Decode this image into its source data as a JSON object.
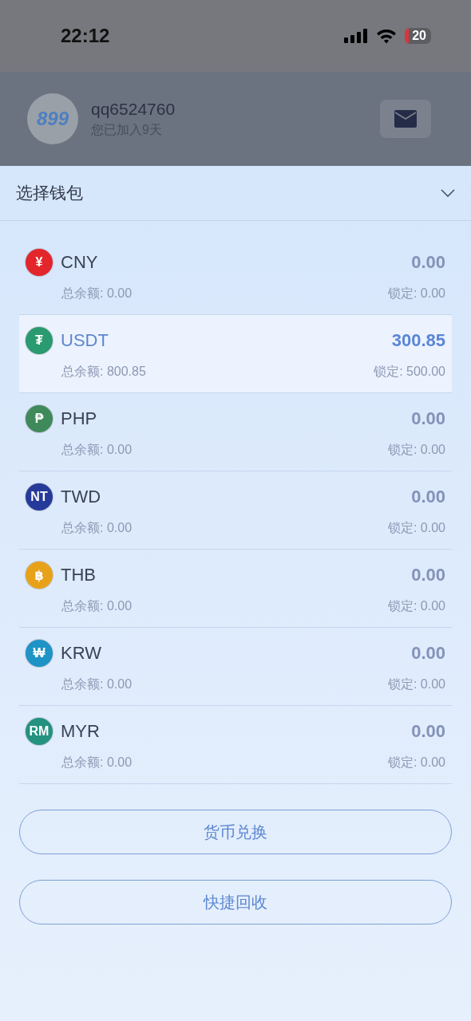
{
  "status_bar": {
    "time": "22:12",
    "battery": "20"
  },
  "profile": {
    "avatar_text": "899",
    "username": "qq6524760",
    "joined": "您已加入9天"
  },
  "sheet": {
    "title": "选择钱包",
    "expanded": true
  },
  "wallets": [
    {
      "symbol": "¥",
      "color": "#e3262b",
      "code": "CNY",
      "amount": "0.00",
      "total": "总余额: 0.00",
      "locked": "锁定: 0.00",
      "selected": false
    },
    {
      "symbol": "₮",
      "color": "#2a9a70",
      "code": "USDT",
      "amount": "300.85",
      "total": "总余额: 800.85",
      "locked": "锁定: 500.00",
      "selected": true
    },
    {
      "symbol": "₱",
      "color": "#3f8a5a",
      "code": "PHP",
      "amount": "0.00",
      "total": "总余额: 0.00",
      "locked": "锁定: 0.00",
      "selected": false
    },
    {
      "symbol": "NT",
      "color": "#263a9a",
      "code": "TWD",
      "amount": "0.00",
      "total": "总余额: 0.00",
      "locked": "锁定: 0.00",
      "selected": false
    },
    {
      "symbol": "฿",
      "color": "#e8a21a",
      "code": "THB",
      "amount": "0.00",
      "total": "总余额: 0.00",
      "locked": "锁定: 0.00",
      "selected": false
    },
    {
      "symbol": "₩",
      "color": "#1e93c6",
      "code": "KRW",
      "amount": "0.00",
      "total": "总余额: 0.00",
      "locked": "锁定: 0.00",
      "selected": false
    },
    {
      "symbol": "RM",
      "color": "#23927f",
      "code": "MYR",
      "amount": "0.00",
      "total": "总余额: 0.00",
      "locked": "锁定: 0.00",
      "selected": false
    }
  ],
  "buttons": [
    "货币兑换",
    "快捷回收"
  ]
}
